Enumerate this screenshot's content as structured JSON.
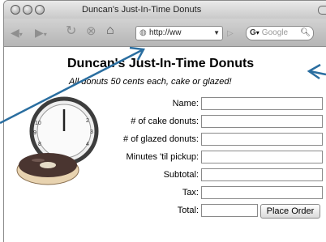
{
  "window": {
    "title": "Duncan's Just-In-Time Donuts"
  },
  "toolbar": {
    "url": "http://ww",
    "search_engine": "G",
    "search_placeholder": "Google"
  },
  "page": {
    "heading": "Duncan's Just-In-Time Donuts",
    "subheading": "All donuts 50 cents each, cake or glazed!",
    "form": {
      "rows": [
        {
          "label": "Name:"
        },
        {
          "label": "# of cake donuts:"
        },
        {
          "label": "# of glazed donuts:"
        },
        {
          "label": "Minutes 'til pickup:"
        },
        {
          "label": "Subtotal:"
        },
        {
          "label": "Tax:"
        },
        {
          "label": "Total:"
        }
      ],
      "submit_label": "Place Order"
    },
    "clock": {
      "numerals": [
        "10",
        "9",
        "8",
        "2",
        "3",
        "4"
      ]
    }
  },
  "icons": {
    "back": "arrow-left-icon",
    "forward": "arrow-right-icon",
    "reload": "reload-icon",
    "stop": "stop-icon",
    "home": "home-icon",
    "url": "globe-icon",
    "go": "go-icon",
    "search": "search-icon"
  },
  "colors": {
    "titlebar": "#c9c9c9",
    "toolbar": "#b5b5b5",
    "annotation_arrow": "#2a6ea0",
    "donut_icing": "#4a3530",
    "donut_dough": "#e8d3b0"
  }
}
